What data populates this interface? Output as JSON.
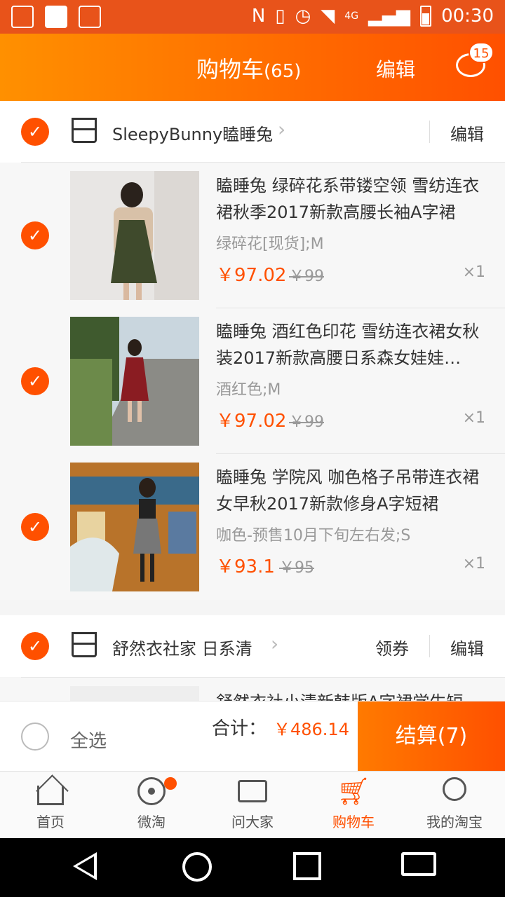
{
  "status_bar": {
    "time": "00:30",
    "network": "4G"
  },
  "header": {
    "title": "购物车",
    "count": "(65)",
    "edit": "编辑",
    "message_badge": "15"
  },
  "shops": [
    {
      "name": "SleepyBunny瞌睡兔",
      "edit": "编辑",
      "coupon": ""
    },
    {
      "name": "舒然衣社家 日系清",
      "edit": "编辑",
      "coupon": "领券"
    }
  ],
  "items": [
    {
      "title": "瞌睡兔 绿碎花系带镂空领 雪纺连衣裙秋季2017新款高腰长袖A字裙",
      "spec": "绿碎花[现货];M",
      "price": "￥97.02",
      "orig": "￥99",
      "qty": "×1"
    },
    {
      "title": "瞌睡兔 酒红色印花 雪纺连衣裙女秋装2017新款高腰日系森女娃娃…",
      "spec": "酒红色;M",
      "price": "￥97.02",
      "orig": "￥99",
      "qty": "×1"
    },
    {
      "title": "瞌睡兔 学院风 咖色格子吊带连衣裙女早秋2017新款修身A字短裙",
      "spec": "咖色-预售10月下旬左右发;S",
      "price": "￥93.1",
      "orig": "￥95",
      "qty": "×1"
    },
    {
      "title": "舒然衣社小清新韩版A字裙学生短",
      "spec": "",
      "price": "",
      "orig": "",
      "qty": ""
    }
  ],
  "checkout": {
    "select_all": "全选",
    "total_label": "合计：",
    "total": "￥486.14",
    "pay": "结算(7)"
  },
  "tabs": [
    {
      "label": "首页",
      "icon": "home-icon"
    },
    {
      "label": "微淘",
      "icon": "radio-icon"
    },
    {
      "label": "问大家",
      "icon": "chat-icon"
    },
    {
      "label": "购物车",
      "icon": "cart-icon"
    },
    {
      "label": "我的淘宝",
      "icon": "user-icon"
    }
  ],
  "colors": {
    "accent": "#ff5000",
    "header_start": "#ff9000"
  }
}
